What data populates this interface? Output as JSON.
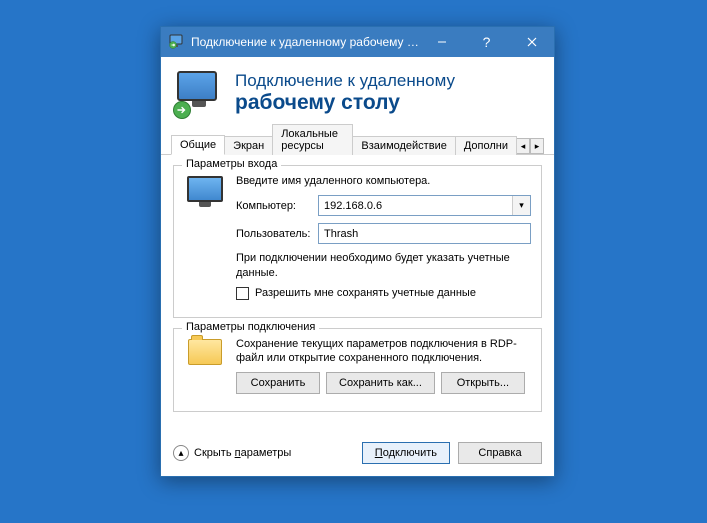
{
  "titlebar": {
    "title": "Подключение к удаленному рабочему с..."
  },
  "header": {
    "line1": "Подключение к удаленному",
    "line2": "рабочему столу"
  },
  "tabs": {
    "items": [
      "Общие",
      "Экран",
      "Локальные ресурсы",
      "Взаимодействие",
      "Дополни"
    ],
    "active_index": 0
  },
  "login_group": {
    "legend": "Параметры входа",
    "hint": "Введите имя удаленного компьютера.",
    "computer_label": "Компьютер:",
    "computer_value": "192.168.0.6",
    "user_label": "Пользователь:",
    "user_value": "Thrash",
    "note": "При подключении необходимо будет указать учетные данные.",
    "save_creds_label": "Разрешить мне сохранять учетные данные"
  },
  "conn_group": {
    "legend": "Параметры подключения",
    "desc": "Сохранение текущих параметров подключения в RDP-файл или открытие сохраненного подключения.",
    "save": "Сохранить",
    "save_as": "Сохранить как...",
    "open": "Открыть..."
  },
  "footer": {
    "collapse": "Скрыть параметры",
    "connect": "Подключить",
    "help": "Справка"
  }
}
